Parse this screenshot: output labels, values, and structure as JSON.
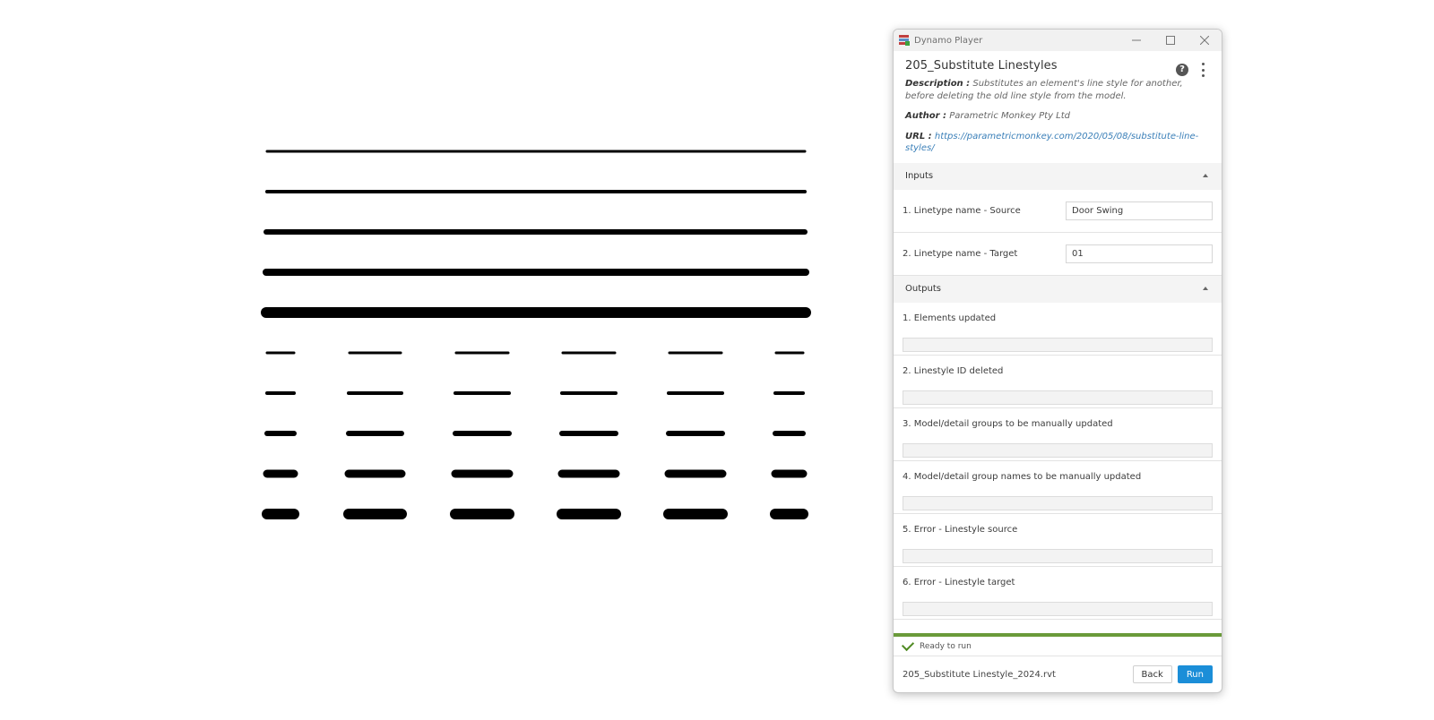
{
  "window": {
    "title": "Dynamo Player"
  },
  "graph": {
    "title": "205_Substitute Linestyles",
    "description_label": "Description :",
    "description": "Substitutes an element's line style for another, before deleting the old line style from the model.",
    "author_label": "Author :",
    "author": "Parametric Monkey Pty Ltd",
    "url_label": "URL :",
    "url": "https://parametricmonkey.com/2020/05/08/substitute-line-styles/"
  },
  "inputs": {
    "header": "Inputs",
    "items": [
      {
        "label": "1. Linetype name - Source",
        "value": "Door Swing"
      },
      {
        "label": "2. Linetype name - Target",
        "value": "01"
      }
    ]
  },
  "outputs": {
    "header": "Outputs",
    "items": [
      {
        "label": "1. Elements updated"
      },
      {
        "label": "2. Linestyle ID deleted"
      },
      {
        "label": "3. Model/detail groups to be manually updated"
      },
      {
        "label": "4. Model/detail group names to be manually updated"
      },
      {
        "label": "5. Error - Linestyle source"
      },
      {
        "label": "6. Error - Linestyle target"
      }
    ]
  },
  "status": {
    "text": "Ready to run",
    "color": "#6a9a3a"
  },
  "footer": {
    "file": "205_Substitute Linestyle_2024.rvt",
    "back_label": "Back",
    "run_label": "Run",
    "run_color": "#1b8ed8"
  },
  "icons": [
    "dynamo-app-icon",
    "minimize-icon",
    "maximize-icon",
    "close-icon",
    "help-icon",
    "more-options-icon",
    "collapse-caret-icon",
    "check-icon"
  ]
}
